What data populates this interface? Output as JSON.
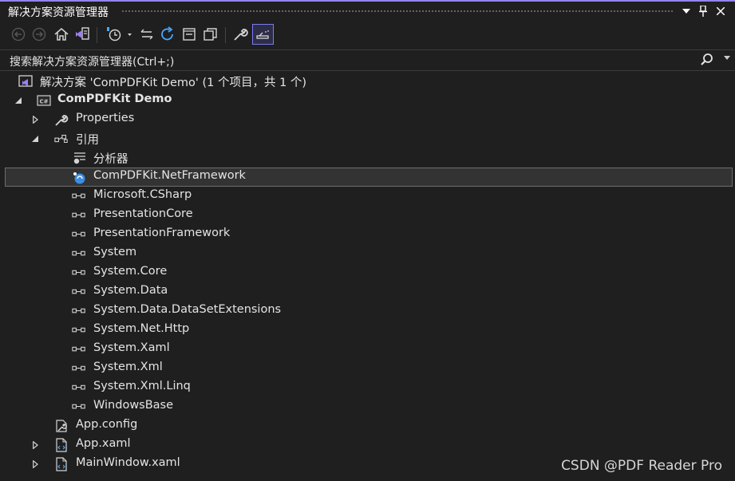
{
  "window": {
    "title": "解决方案资源管理器",
    "buttons": {
      "dropdown": "▾",
      "pin": "pin",
      "close": "✕"
    }
  },
  "toolbar": {
    "items": [
      "back-icon",
      "forward-icon",
      "home-icon",
      "switch-views-icon",
      "pending-changes-filter-icon",
      "sync-active-document-icon",
      "refresh-icon",
      "collapse-all-icon",
      "show-all-files-icon",
      "properties-icon",
      "preview-selected-items-icon"
    ]
  },
  "search": {
    "placeholder": "搜索解决方案资源管理器(Ctrl+;)"
  },
  "tree": {
    "solution": {
      "label": "解决方案 'ComPDFKit Demo' (1 个项目，共 1 个)"
    },
    "project": {
      "label": "ComPDFKit Demo",
      "badge": "C#"
    },
    "properties": {
      "label": "Properties"
    },
    "references": {
      "label": "引用",
      "analyzers": "分析器",
      "items": [
        "ComPDFKit.NetFramework",
        "Microsoft.CSharp",
        "PresentationCore",
        "PresentationFramework",
        "System",
        "System.Core",
        "System.Data",
        "System.Data.DataSetExtensions",
        "System.Net.Http",
        "System.Xaml",
        "System.Xml",
        "System.Xml.Linq",
        "WindowsBase"
      ]
    },
    "files": [
      {
        "label": "App.config",
        "expandable": false
      },
      {
        "label": "App.xaml",
        "expandable": true
      },
      {
        "label": "MainWindow.xaml",
        "expandable": true
      }
    ]
  },
  "watermark": "CSDN @PDF Reader Pro",
  "colors": {
    "accent": "#9184ee",
    "background": "#1f1f1f",
    "selection": "#333333",
    "text": "#e4e4e4"
  }
}
